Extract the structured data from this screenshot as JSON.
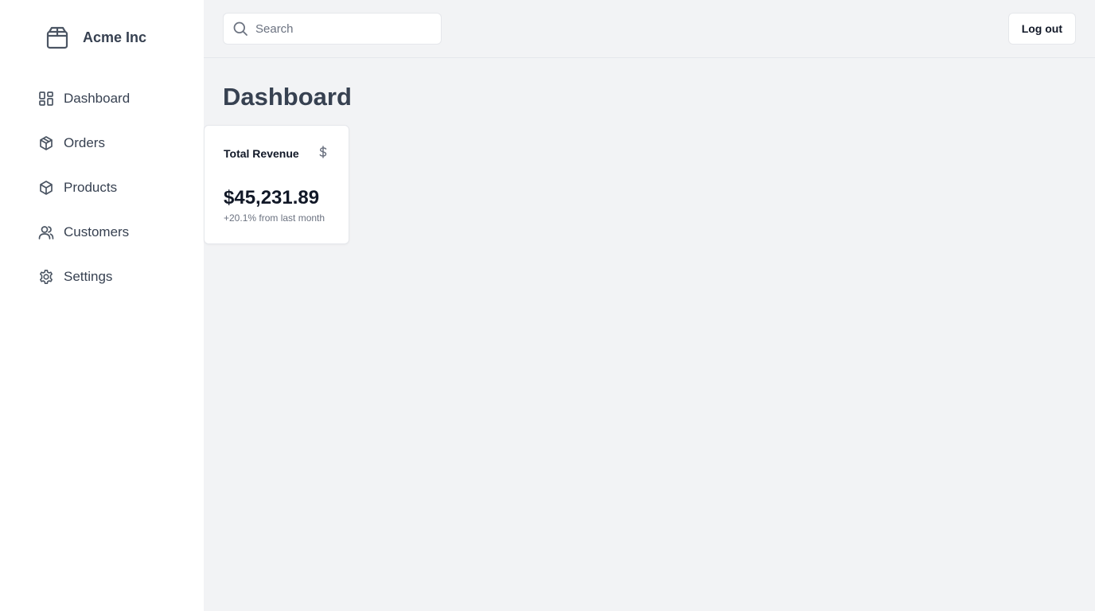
{
  "brand": {
    "name": "Acme Inc",
    "icon": "package-box-icon"
  },
  "sidebar": {
    "items": [
      {
        "label": "Dashboard",
        "icon": "dashboard-grid-icon"
      },
      {
        "label": "Orders",
        "icon": "package-icon"
      },
      {
        "label": "Products",
        "icon": "package-icon"
      },
      {
        "label": "Customers",
        "icon": "users-icon"
      },
      {
        "label": "Settings",
        "icon": "gear-icon"
      }
    ]
  },
  "header": {
    "search": {
      "placeholder": "Search",
      "value": ""
    },
    "logout_label": "Log out"
  },
  "main": {
    "title": "Dashboard",
    "card": {
      "title": "Total Revenue",
      "icon": "dollar-icon",
      "value": "$45,231.89",
      "subtext": "+20.1% from last month"
    }
  },
  "colors": {
    "sidebar_bg": "#ffffff",
    "page_bg": "#f2f3f5",
    "border": "#e5e7eb",
    "text": "#374151",
    "muted": "#6b7280"
  }
}
